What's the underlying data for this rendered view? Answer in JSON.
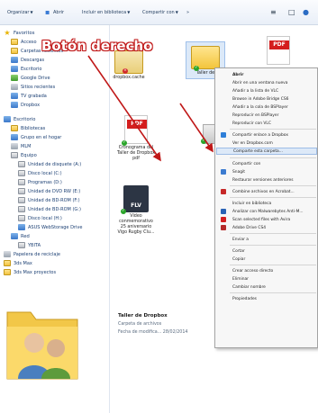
{
  "toolbar": {
    "organize": "Organizar",
    "open": "Abrir",
    "library": "Incluir en biblioteca",
    "share": "Compartir con",
    "more": "»"
  },
  "nav": {
    "favorites": "Favoritos",
    "fav_items": [
      "Acceso",
      "Carpetas recientes",
      "Descargas",
      "Escritorio",
      "Google Drive",
      "Sitios recientes",
      "TV grabada",
      "Dropbox"
    ],
    "desktop": "Escritorio",
    "desk_items": [
      "Bibliotecas",
      "Grupo en el hogar",
      "MLM"
    ],
    "computer": "Equipo",
    "drives": [
      "Unidad de disquete (A:)",
      "Disco local (C:)",
      "Programas (D:)",
      "Unidad de DVD RW (E:)",
      "Unidad de BD-ROM (F:)",
      "Unidad de BD-ROM (G:)",
      "Disco local (H:)",
      "ASUS WebStorage Drive"
    ],
    "network": "Red",
    "net_items": [
      "YBITA",
      "Papelera de reciclaje",
      "3ds Max",
      "3ds Max proyectos"
    ]
  },
  "files": [
    {
      "name": "dropbox.cache"
    },
    {
      "name": "Taller de"
    },
    {
      "name": "Cronograma del Taller de Dropbox pdf"
    },
    {
      "name": "Video conmemorativo 25 aniversario Vigo Rugby Clu..."
    }
  ],
  "annotation": "Botón derecho",
  "details": {
    "name": "Taller de Dropbox",
    "type": "Carpeta de archivos",
    "modified": "Fecha de modifica... 28/02/2014"
  },
  "menu": {
    "items": [
      "Abrir",
      "Abrir en una ventana nueva",
      "Añadir a la lista de VLC",
      "Browse in Adobe Bridge CS6",
      "Añadir a la cola de BSPlayer",
      "Reproducir en BSPlayer",
      "Reproducir con VLC",
      "Compartir enlace a Dropbox",
      "Ver en Dropbox.com",
      "Comparte esta carpeta...",
      "Compartir con",
      "Snagit",
      "Restaurar versiones anteriores",
      "Combine archivos en Acrobat...",
      "Incluir en biblioteca",
      "Analizar con Malwarebytes Anti-M...",
      "Scan selected files with Avira",
      "Adobe Drive CS4",
      "Enviar a",
      "Cortar",
      "Copiar",
      "Crear acceso directo",
      "Eliminar",
      "Cambiar nombre",
      "Propiedades"
    ]
  },
  "icons": {
    "annotation_color": "#c01818",
    "folder": "folder-icon",
    "pdf": "pdf-icon",
    "flv": "flv-icon"
  }
}
